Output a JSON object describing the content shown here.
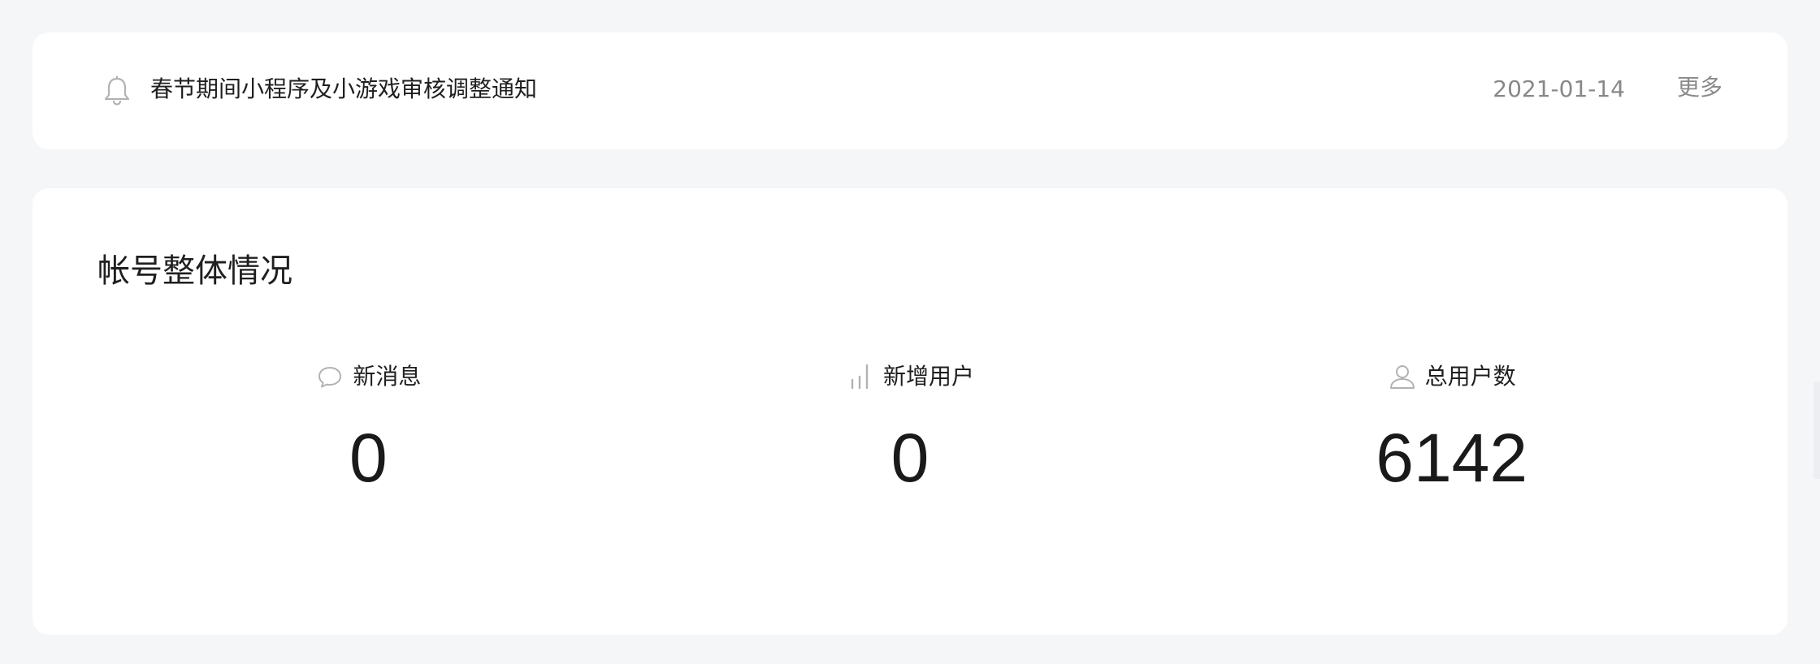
{
  "notice": {
    "icon": "bell-icon",
    "title": "春节期间小程序及小游戏审核调整通知",
    "date": "2021-01-14",
    "more_label": "更多"
  },
  "overview": {
    "title": "帐号整体情况",
    "stats": [
      {
        "icon": "message-icon",
        "label": "新消息",
        "value": "0"
      },
      {
        "icon": "bar-chart-icon",
        "label": "新增用户",
        "value": "0"
      },
      {
        "icon": "user-icon",
        "label": "总用户数",
        "value": "6142"
      }
    ]
  },
  "colors": {
    "background": "#f5f6f8",
    "card": "#ffffff",
    "text_primary": "#1f1f1f",
    "text_secondary": "#888888",
    "icon_gray": "#b2b2b2"
  }
}
